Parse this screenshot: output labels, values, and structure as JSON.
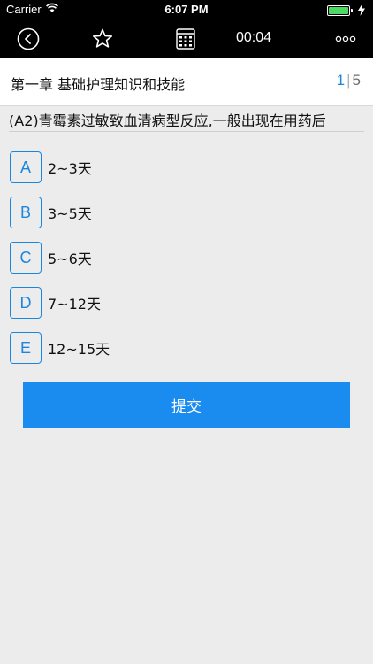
{
  "status_bar": {
    "carrier": "Carrier",
    "time": "6:07 PM",
    "battery_color": "#4cd964"
  },
  "nav_bar": {
    "icons": [
      "back-icon",
      "star-icon",
      "answer-sheet-icon",
      "more-icon"
    ],
    "timer": "00:04"
  },
  "chapter": {
    "title": "第一章 基础护理知识和技能",
    "current": "1",
    "separator": "|",
    "total": "5"
  },
  "question": {
    "text": "(A2)青霉素过敏致血清病型反应,一般出现在用药后"
  },
  "options": [
    {
      "letter": "A",
      "text": "2~3天"
    },
    {
      "letter": "B",
      "text": "3~5天"
    },
    {
      "letter": "C",
      "text": "5~6天"
    },
    {
      "letter": "D",
      "text": "7~12天"
    },
    {
      "letter": "E",
      "text": "12~15天"
    }
  ],
  "submit_label": "提交",
  "colors": {
    "accent": "#1a86e0",
    "submit_bg": "#1a8cf0",
    "background": "#ececec"
  }
}
